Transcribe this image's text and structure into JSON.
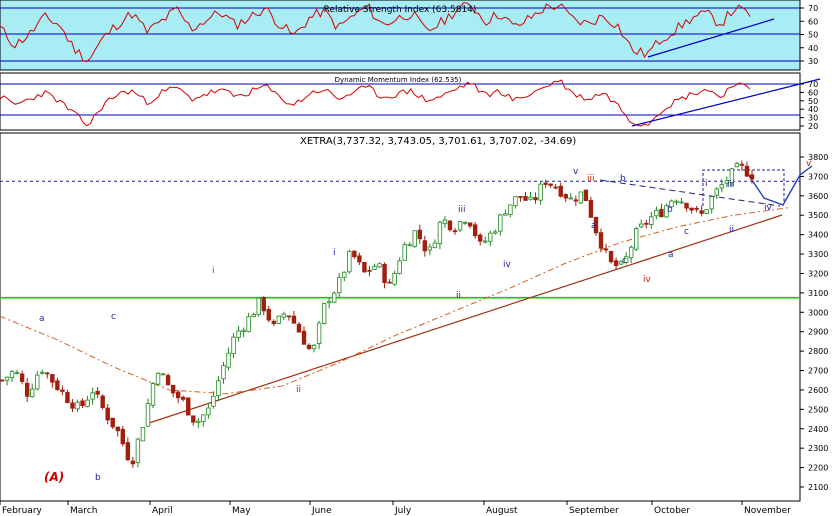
{
  "rsi_panel": {
    "title": "Relative Strength Index (63.5814)",
    "y_ticks": [
      30,
      40,
      50,
      60,
      70
    ],
    "bg_color": "#a8ecf4",
    "line_color": "#d40000",
    "band_color": "#0000c0"
  },
  "dm_panel": {
    "title": "Dynamic Momentum Index (62.535)",
    "y_ticks": [
      20,
      30,
      40,
      50,
      60,
      70
    ],
    "bg_color": "#ffffff"
  },
  "main_panel": {
    "title": "XETRA(3,737.32, 3,743.05, 3,701.61, 3,707.02, -34.69)",
    "y_ticks": [
      2100,
      2200,
      2300,
      2400,
      2500,
      2600,
      2700,
      2800,
      2900,
      3000,
      3100,
      3200,
      3300,
      3400,
      3500,
      3600,
      3700,
      3800
    ],
    "support_level": 3075,
    "resistance_level": 3675,
    "up_color": "#1f8a1f",
    "down_color": "#a02010"
  },
  "months": [
    "February",
    "March",
    "April",
    "May",
    "June",
    "July",
    "August",
    "September",
    "October",
    "November"
  ],
  "wave_labels": {
    "A": "(A)",
    "a1": "a",
    "b1": "b",
    "c1": "c",
    "i_big": "i",
    "ii_big": "ii",
    "iii_big": "iii",
    "i_small": "i",
    "ii_small": "ii",
    "iii_small": "iii",
    "iv_small": "iv",
    "v_small": "v",
    "a2": "a",
    "b2": "b",
    "c2": "c",
    "iv_big": "iv",
    "a3": "a",
    "b3": "b",
    "c3": "c",
    "i3": "i",
    "ii3": "ii",
    "iii3": "iii",
    "iv3": "iv",
    "v3": "v"
  },
  "chart_data": {
    "type": "candlestick",
    "title": "XETRA(3,737.32, 3,743.05, 3,701.61, 3,707.02, -34.69)",
    "ylim": [
      2100,
      3900
    ],
    "x_labels": [
      "February",
      "March",
      "April",
      "May",
      "June",
      "July",
      "August",
      "September",
      "October",
      "November"
    ],
    "price_path": [
      2650,
      2700,
      2580,
      2720,
      2640,
      2560,
      2500,
      2600,
      2480,
      2380,
      2220,
      2450,
      2720,
      2600,
      2540,
      2430,
      2500,
      2700,
      2880,
      2960,
      3060,
      2920,
      3010,
      2900,
      2780,
      3050,
      3140,
      3310,
      3200,
      3250,
      3130,
      3330,
      3420,
      3300,
      3480,
      3440,
      3500,
      3340,
      3420,
      3540,
      3600,
      3560,
      3680,
      3640,
      3580,
      3620,
      3410,
      3250,
      3230,
      3400,
      3480,
      3520,
      3600,
      3560,
      3490,
      3600,
      3680,
      3750,
      3710
    ],
    "moving_average_path": [
      2980,
      2860,
      2720,
      2600,
      2580,
      2620,
      2740,
      2880,
      3000,
      3120,
      3250,
      3360,
      3440,
      3500,
      3540
    ],
    "rsi": {
      "title": "Relative Strength Index (63.5814)",
      "ylim": [
        20,
        80
      ],
      "bands": [
        30,
        50,
        70
      ],
      "values": [
        55,
        42,
        50,
        63,
        58,
        40,
        30,
        47,
        58,
        66,
        52,
        60,
        69,
        54,
        61,
        67,
        57,
        63,
        70,
        58,
        49,
        62,
        68,
        55,
        64,
        71,
        57,
        62,
        66,
        52,
        59,
        68,
        73,
        60,
        66,
        55,
        62,
        70,
        72,
        61,
        58,
        64,
        57,
        38,
        35,
        47,
        54,
        62,
        66,
        58,
        70,
        65
      ]
    },
    "dynamic_momentum": {
      "title": "Dynamic Momentum Index (62.535)",
      "ylim": [
        10,
        80
      ],
      "bands": [
        30,
        70
      ],
      "values": [
        55,
        45,
        52,
        60,
        50,
        35,
        20,
        45,
        58,
        62,
        48,
        60,
        66,
        52,
        58,
        63,
        55,
        60,
        68,
        54,
        45,
        58,
        64,
        52,
        60,
        66,
        54,
        58,
        62,
        50,
        55,
        64,
        72,
        56,
        62,
        50,
        58,
        66,
        75,
        58,
        52,
        60,
        45,
        25,
        22,
        40,
        50,
        58,
        64,
        55,
        72,
        62
      ]
    }
  }
}
